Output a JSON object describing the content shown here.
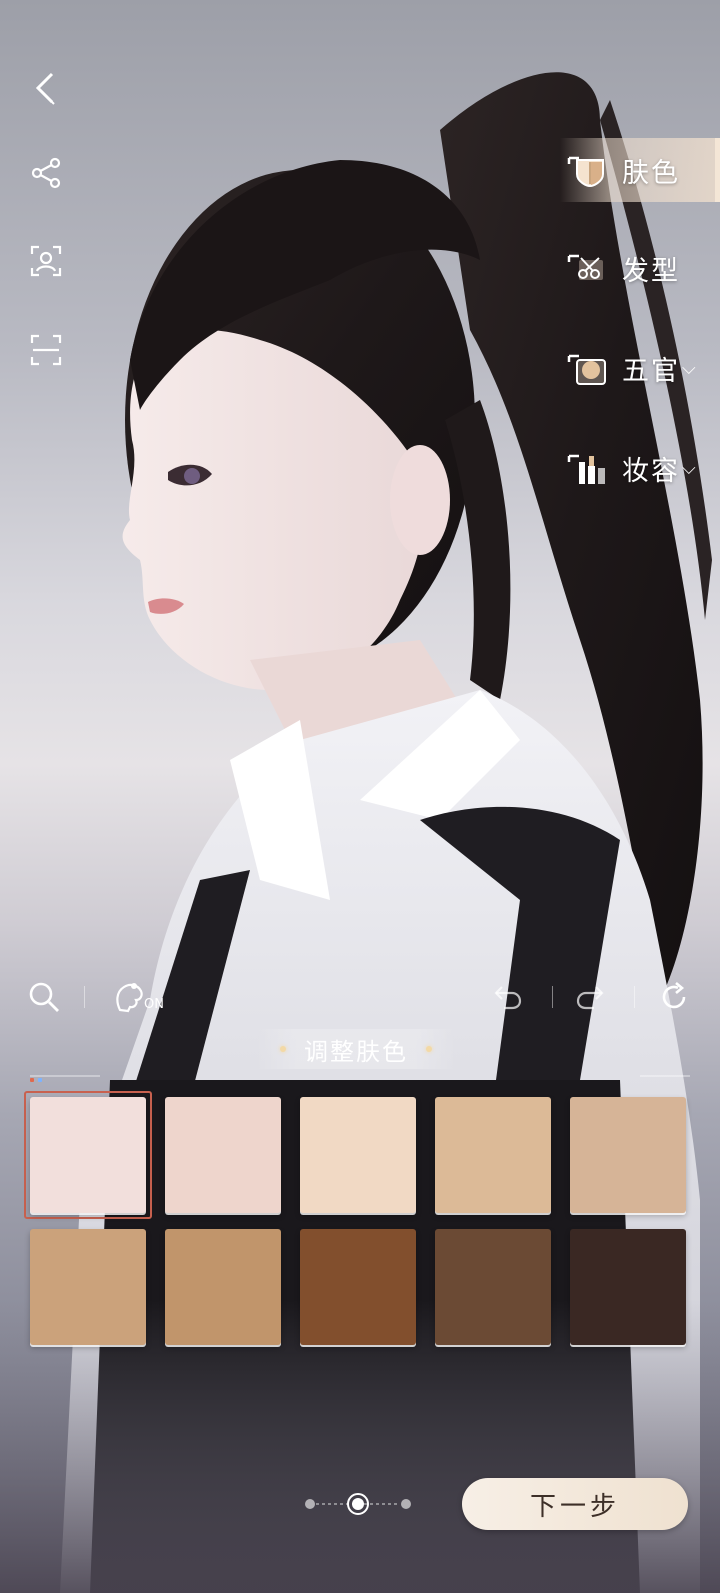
{
  "categories": [
    {
      "label": "肤色",
      "icon": "skin-tone-icon",
      "active": true
    },
    {
      "label": "发型",
      "icon": "hairstyle-icon",
      "active": false
    },
    {
      "label": "五官",
      "icon": "facial-features-icon",
      "active": false,
      "expandable": true
    },
    {
      "label": "妆容",
      "icon": "makeup-icon",
      "active": false,
      "expandable": true
    }
  ],
  "toolbar": {
    "hair_toggle_state": "ON"
  },
  "section_title": "调整肤色",
  "swatches": {
    "selected_index": 0,
    "colors": [
      "#f2dfdc",
      "#eed5cc",
      "#f1d9c4",
      "#dcba97",
      "#d6b497",
      "#cba27b",
      "#c1956b",
      "#824f2d",
      "#6b4a34",
      "#3a2823"
    ]
  },
  "pager": {
    "pages": 3,
    "current": 2
  },
  "next_button_label": "下一步"
}
